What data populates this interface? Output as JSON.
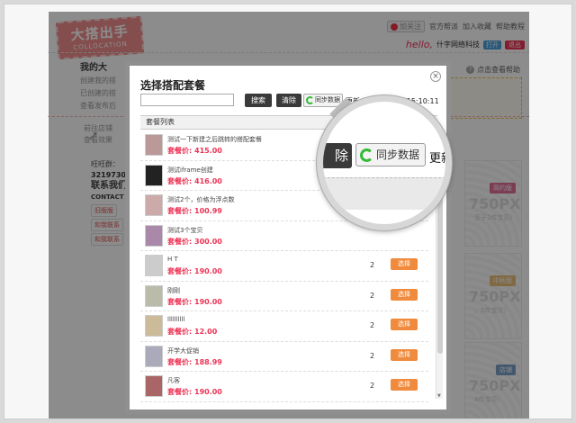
{
  "header": {
    "logo_main": "大搭出手",
    "logo_sub": "COLLOCATION",
    "follow_label": "加关注",
    "links": [
      "官方帮派",
      "加入收藏",
      "帮助教程"
    ],
    "hello": "hello,",
    "user_name": "什字网络科技",
    "user_badge": "打开",
    "logout": "退出",
    "help": "点击查看帮助"
  },
  "left": {
    "title": "我的大",
    "lines": [
      "创建我的搭",
      "已创建的搭",
      "查看发布后"
    ],
    "store_lines": [
      "前往店铺",
      "查看效果"
    ],
    "wangwang": "旺旺群：",
    "qq": "321973023",
    "contact_title": "联系我们",
    "contact_en": "CONTACT",
    "btn1": "旧版版",
    "btn2": "和我联系",
    "btn3": "和我联系"
  },
  "promos": [
    {
      "label": "简约版",
      "px": "750PX",
      "sub": "至于2件宝贝）",
      "color": "#e06e9a"
    },
    {
      "label": "中秋版",
      "px": "750PX",
      "sub": "，5件宝贝）",
      "color": "#e9c07a"
    },
    {
      "label": "店铺",
      "px": "750PX",
      "sub": "4件宝贝）",
      "color": "#7aa0c9"
    }
  ],
  "modal": {
    "title": "选择搭配套餐",
    "search_placeholder": "",
    "search_btn": "搜索",
    "clear_btn": "清除",
    "sync_btn": "同步数据",
    "update_text": "更新:2011-10-18 15:10:11",
    "list_header": "套餐列表",
    "price_label": "套餐价:",
    "select_label": "选择",
    "rows": [
      {
        "name": "测试一下新建之后跳转的搭配套餐",
        "price": "415.00",
        "count": "",
        "thumb": "#b99"
      },
      {
        "name": "测试iframe创建",
        "price": "416.00",
        "count": "",
        "thumb": "#222"
      },
      {
        "name": "测试2个，价格为浮点数",
        "price": "100.99",
        "count": "",
        "thumb": "#caa"
      },
      {
        "name": "测试3个宝贝",
        "price": "300.00",
        "count": "",
        "thumb": "#a8a"
      },
      {
        "name": "H T",
        "price": "190.00",
        "count": "2",
        "thumb": "#ccc"
      },
      {
        "name": "刚刚",
        "price": "190.00",
        "count": "2",
        "thumb": "#bba"
      },
      {
        "name": "llllllllll",
        "price": "12.00",
        "count": "2",
        "thumb": "#cb9"
      },
      {
        "name": "开学大促销",
        "price": "188.99",
        "count": "2",
        "thumb": "#aab"
      },
      {
        "name": "凡客",
        "price": "190.00",
        "count": "2",
        "thumb": "#a66"
      }
    ]
  },
  "magnifier": {
    "del_text": "除",
    "sync_text": "同步数据",
    "update_text": "更新:2"
  }
}
